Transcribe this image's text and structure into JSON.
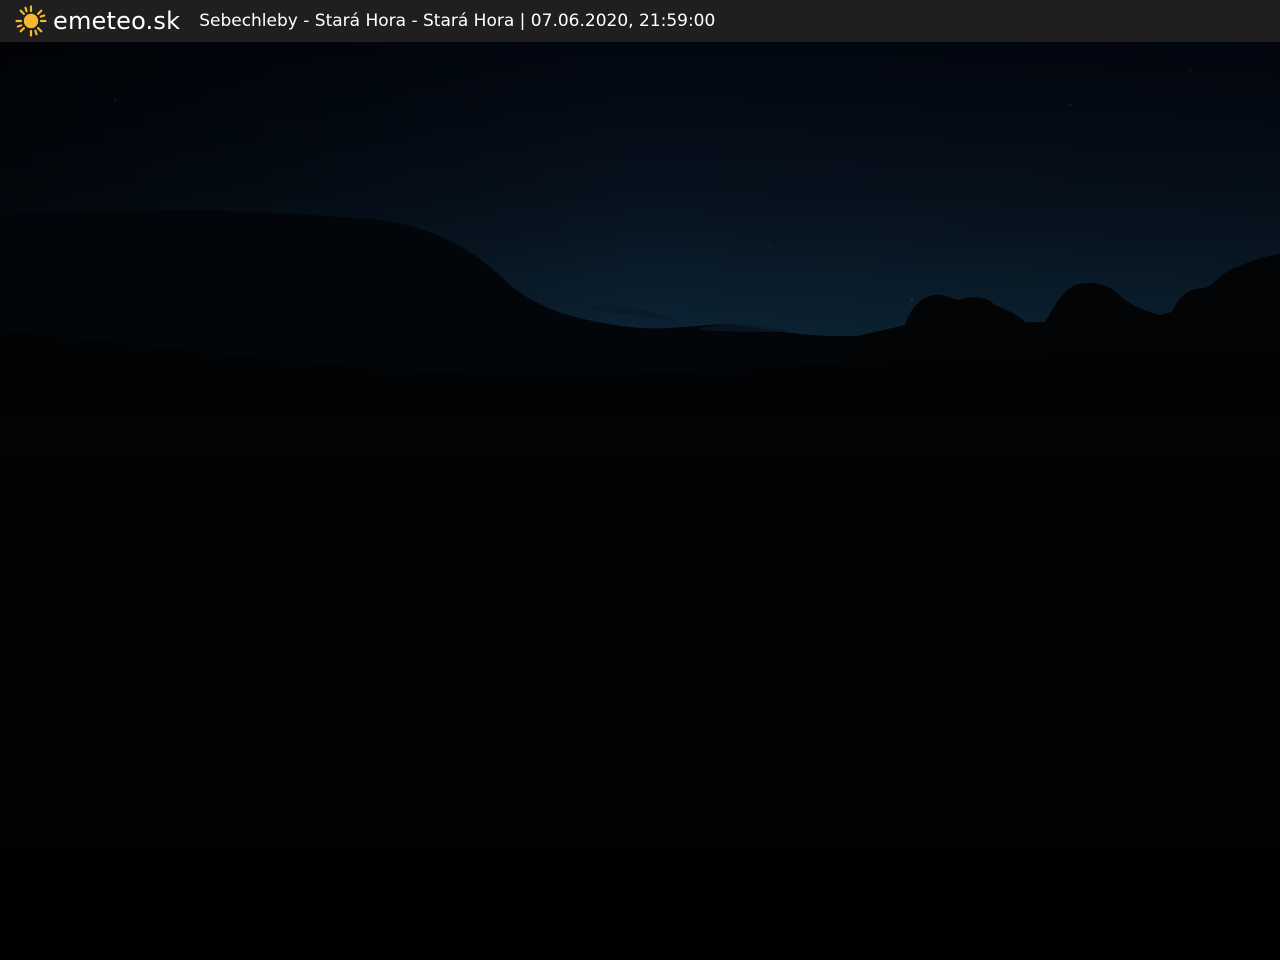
{
  "header": {
    "brand": "emeteo.sk",
    "logo_icon": "sun-icon",
    "caption": "Sebechleby - Stará Hora - Stará Hora | 07.06.2020, 21:59:00"
  },
  "colors": {
    "bar_background": "#1f1f1f",
    "sun": "#f5b82e",
    "text": "#ffffff",
    "sky_top": "#030711",
    "sky_horizon": "#0c2434",
    "ground": "#010101"
  }
}
